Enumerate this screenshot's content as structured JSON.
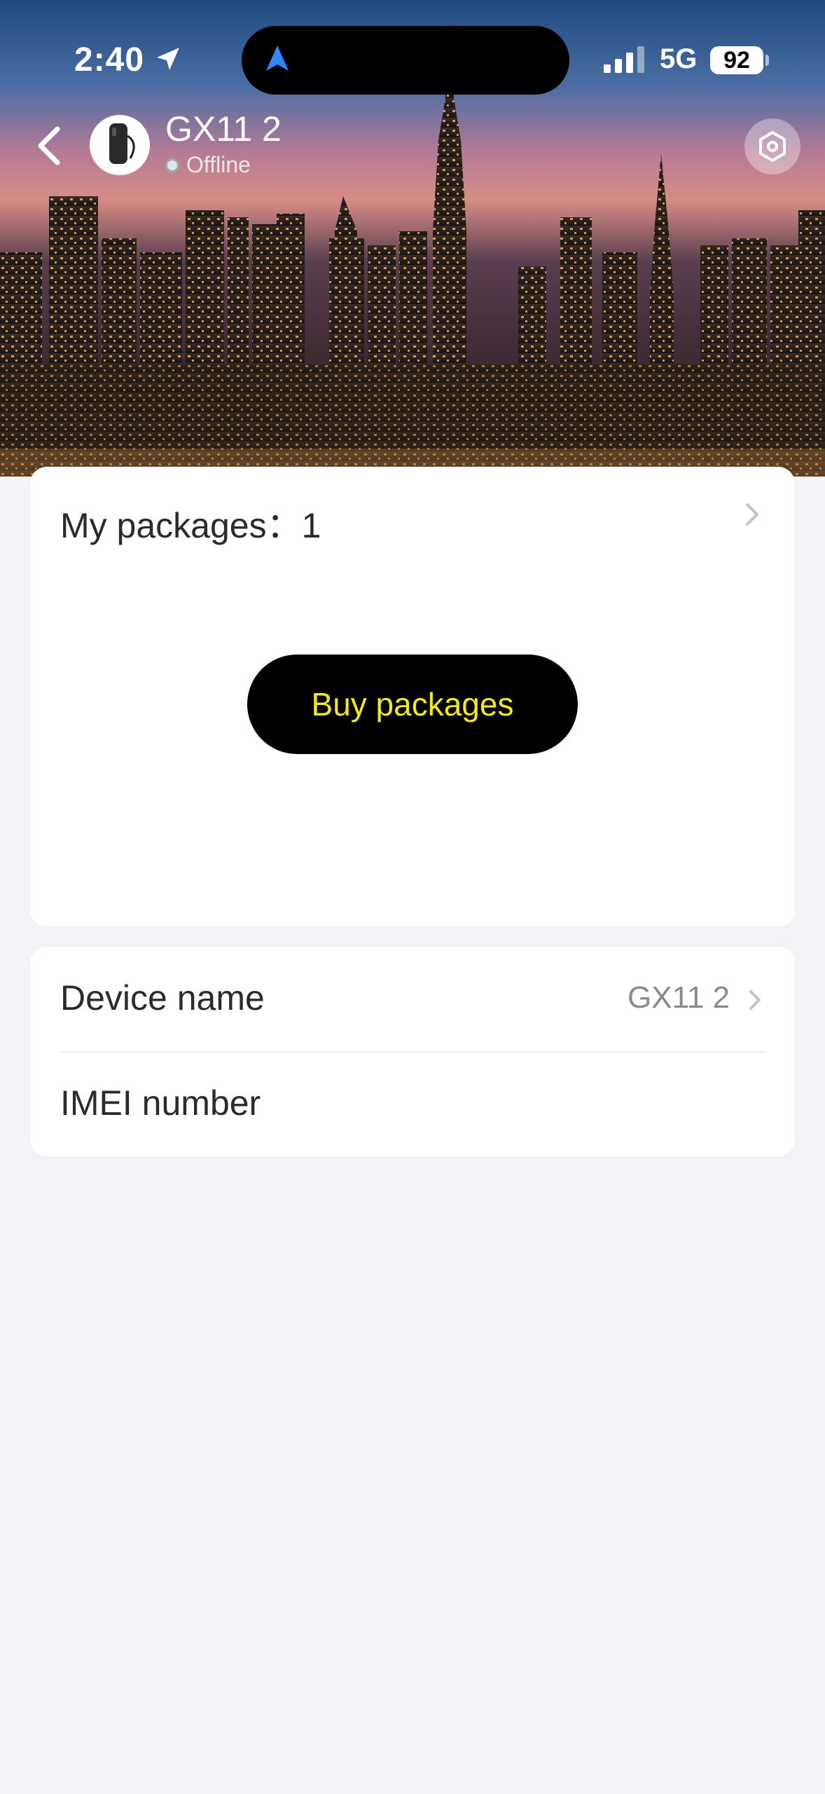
{
  "status_bar": {
    "time": "2:40",
    "network": "5G",
    "battery": "92"
  },
  "header": {
    "device_name": "GX11 2",
    "status": "Offline"
  },
  "packages_card": {
    "label": "My packages：1",
    "buy_button": "Buy packages"
  },
  "info_card": {
    "rows": [
      {
        "label": "Device name",
        "value": "GX11 2"
      },
      {
        "label": "IMEI number",
        "value": ""
      }
    ]
  },
  "colors": {
    "page_bg": "#f2f3f7",
    "button_bg": "#000000",
    "button_text": "#f3e81d",
    "card_bg": "#ffffff"
  },
  "icons": [
    "location-arrow-icon",
    "navigation-arrow-icon",
    "signal-icon",
    "battery-icon",
    "back-chevron-icon",
    "settings-icon",
    "chevron-right-icon"
  ]
}
